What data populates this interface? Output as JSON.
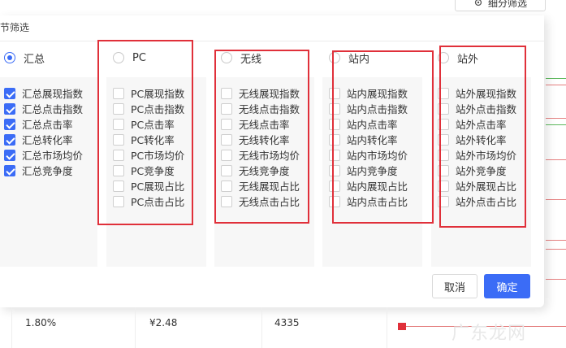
{
  "header": {
    "filter_button": "细分筛选"
  },
  "modal": {
    "title": "节筛选",
    "columns": [
      {
        "name": "汇总",
        "selected": true,
        "items": [
          "汇总展现指数",
          "汇总点击指数",
          "汇总点击率",
          "汇总转化率",
          "汇总市场均价",
          "汇总竞争度"
        ],
        "checked": [
          true,
          true,
          true,
          true,
          true,
          true
        ]
      },
      {
        "name": "PC",
        "selected": false,
        "items": [
          "PC展现指数",
          "PC点击指数",
          "PC点击率",
          "PC转化率",
          "PC市场均价",
          "PC竞争度",
          "PC展现占比",
          "PC点击占比"
        ],
        "checked": [
          false,
          false,
          false,
          false,
          false,
          false,
          false,
          false
        ]
      },
      {
        "name": "无线",
        "selected": false,
        "items": [
          "无线展现指数",
          "无线点击指数",
          "无线点击率",
          "无线转化率",
          "无线市场均价",
          "无线竞争度",
          "无线展现占比",
          "无线点击占比"
        ],
        "checked": [
          false,
          false,
          false,
          false,
          false,
          false,
          false,
          false
        ]
      },
      {
        "name": "站内",
        "selected": false,
        "items": [
          "站内展现指数",
          "站内点击指数",
          "站内点击率",
          "站内转化率",
          "站内市场均价",
          "站内竞争度",
          "站内展现占比",
          "站内点击占比"
        ],
        "checked": [
          false,
          false,
          false,
          false,
          false,
          false,
          false,
          false
        ]
      },
      {
        "name": "站外",
        "selected": false,
        "items": [
          "站外展现指数",
          "站外点击指数",
          "站外点击率",
          "站外转化率",
          "站外市场均价",
          "站外竞争度",
          "站外展现占比",
          "站外点击占比"
        ],
        "checked": [
          false,
          false,
          false,
          false,
          false,
          false,
          false,
          false
        ]
      }
    ],
    "cancel_label": "取消",
    "confirm_label": "确定"
  },
  "table_row": {
    "rate": "1.80%",
    "price": "¥2.48",
    "count": "4335"
  },
  "watermark": "广东龙网",
  "colors": {
    "accent": "#3b6cf6",
    "highlight_box": "#e0303a"
  }
}
